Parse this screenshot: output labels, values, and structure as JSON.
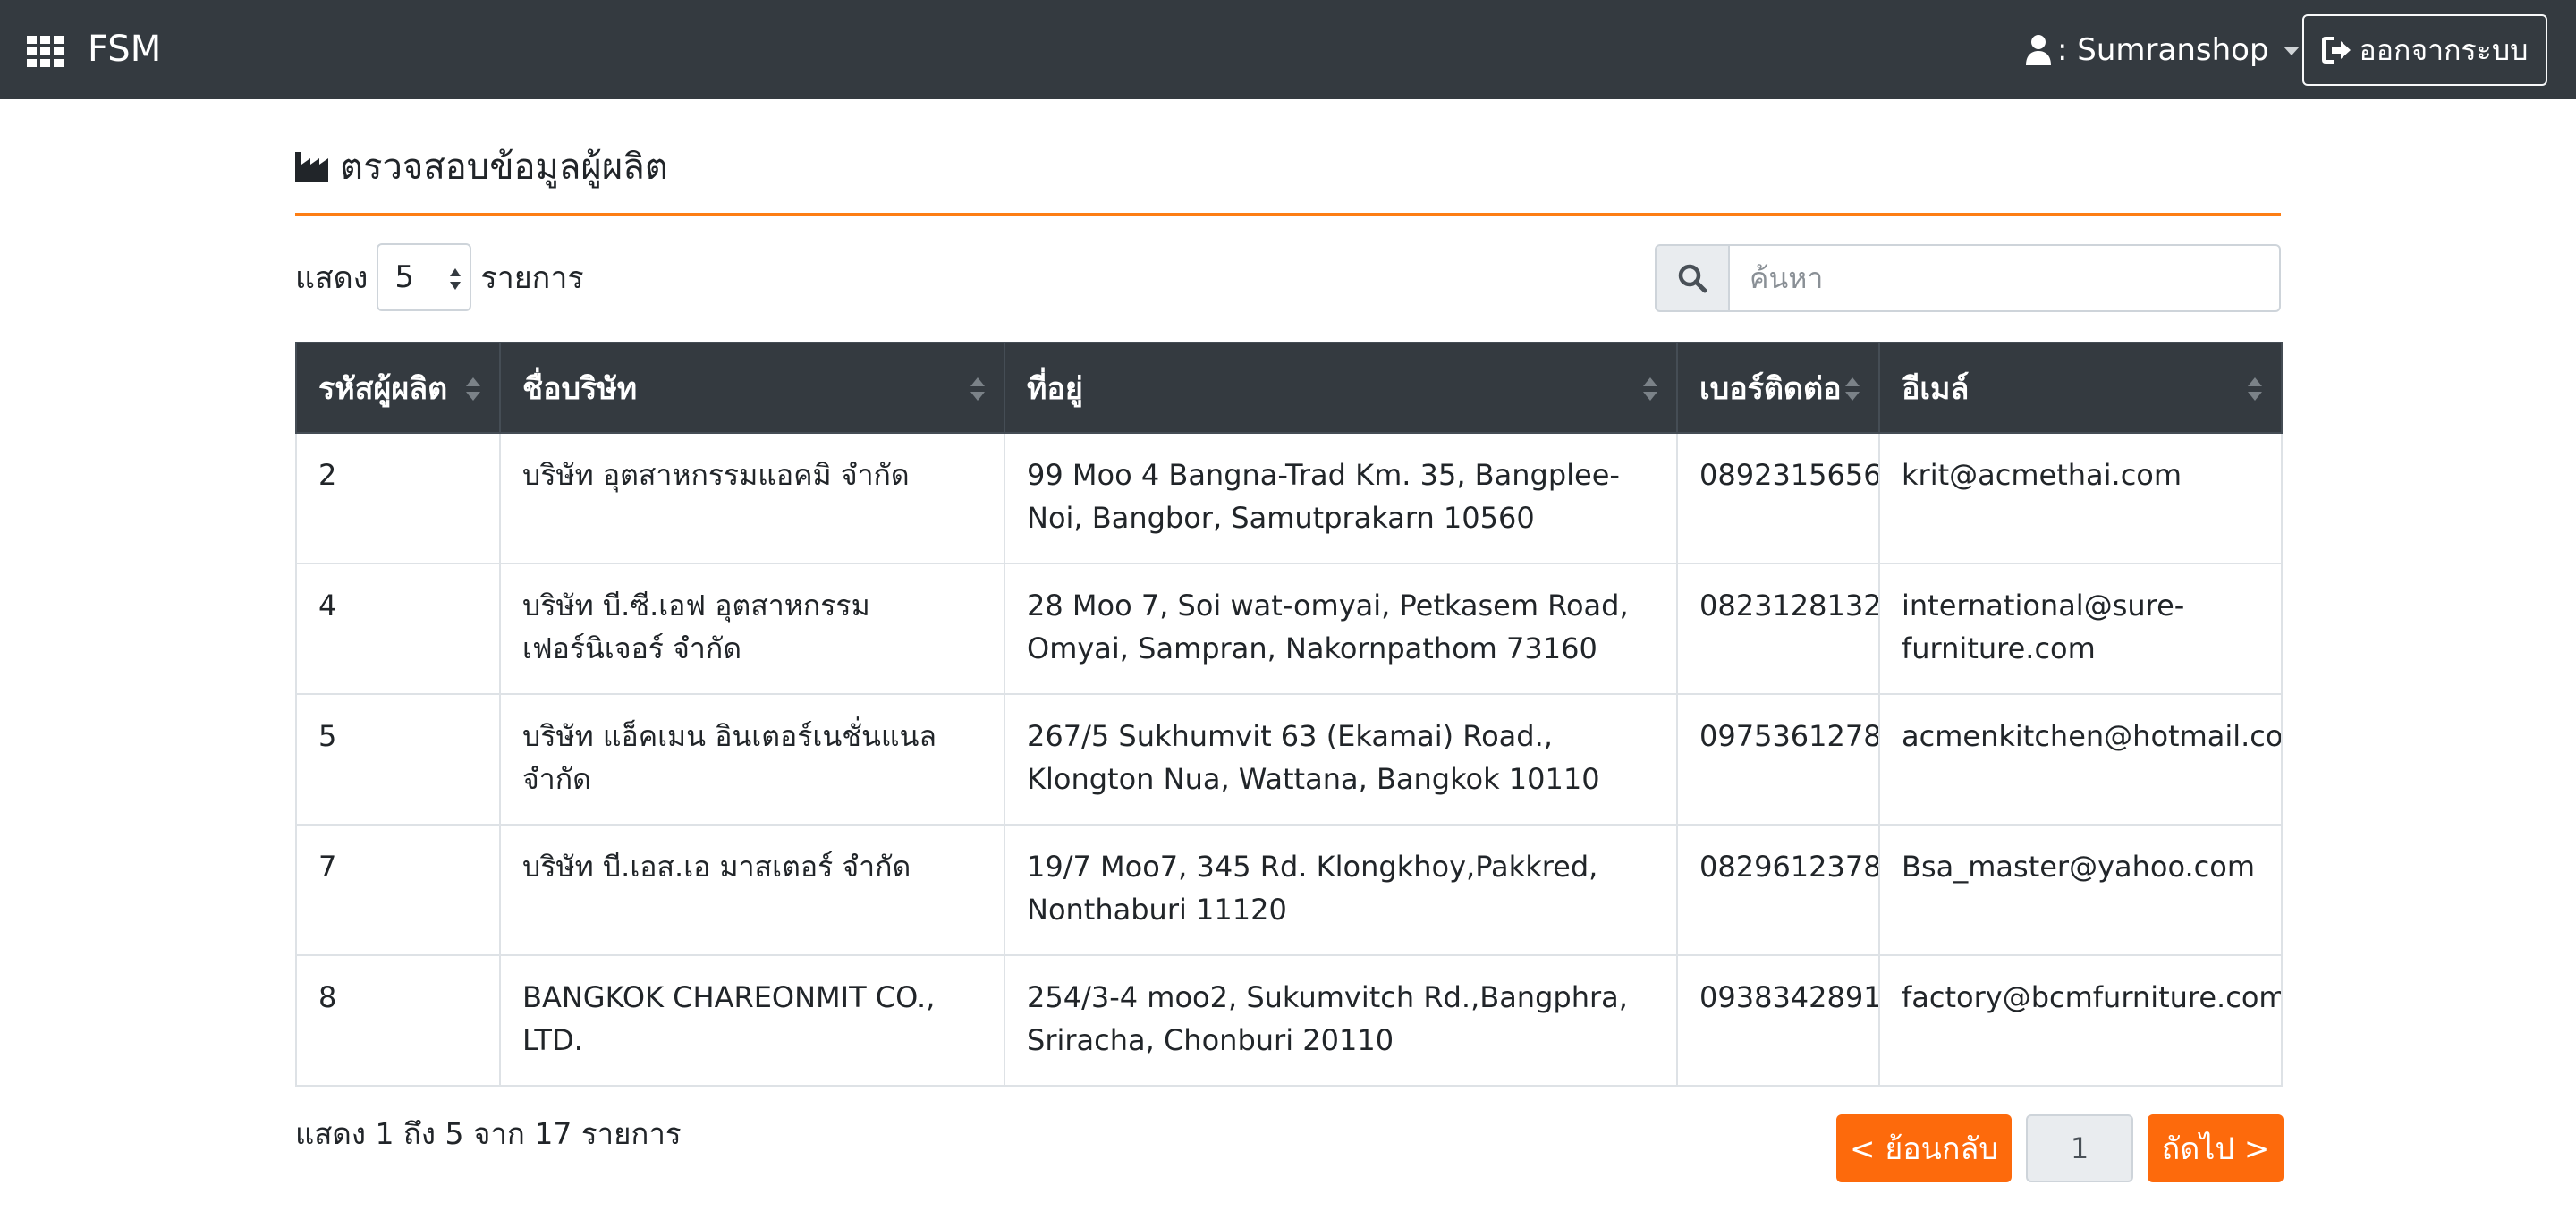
{
  "navbar": {
    "brand": "FSM",
    "apps_icon": "grid-apps-icon",
    "user_label": ": Sumranshop",
    "logout_label": "ออกจากระบบ"
  },
  "page": {
    "title": "ตรวจสอบข้อมูลผู้ผลิต",
    "title_icon": "factory-icon",
    "accent_color": "#fd7e14"
  },
  "length": {
    "show_label": "แสดง",
    "value": "5",
    "entries_label": "รายการ"
  },
  "search": {
    "placeholder": "ค้นหา",
    "value": ""
  },
  "table": {
    "headers": [
      "รหัสผู้ผลิต",
      "ชื่อบริษัท",
      "ที่อยู่",
      "เบอร์ติดต่อ",
      "อีเมล์"
    ],
    "rows": [
      [
        "2",
        "บริษัท อุตสาหกรรมแอคมิ จำกัด",
        "99 Moo 4 Bangna-Trad Km. 35, Bangplee-Noi, Bangbor, Samutprakarn 10560",
        "0892315656",
        "krit@acmethai.com"
      ],
      [
        "4",
        "บริษัท บี.ซี.เอฟ อุตสาหกรรมเฟอร์นิเจอร์ จำกัด",
        "28 Moo 7, Soi wat-omyai, Petkasem Road, Omyai, Sampran, Nakornpathom 73160",
        "0823128132",
        "international@sure-furniture.com"
      ],
      [
        "5",
        "บริษัท แอ็คเมน อินเตอร์เนชั่นแนล จำกัด",
        "267/5 Sukhumvit 63 (Ekamai) Road., Klongton Nua, Wattana, Bangkok 10110",
        "0975361278",
        "acmenkitchen@hotmail.com"
      ],
      [
        "7",
        "บริษัท บี.เอส.เอ มาสเตอร์ จำกัด",
        "19/7 Moo7, 345 Rd. Klongkhoy,Pakkred, Nonthaburi 11120",
        "0829612378",
        "Bsa_master@yahoo.com"
      ],
      [
        "8",
        "BANGKOK CHAREONMIT CO., LTD.",
        "254/3-4 moo2, Sukumvitch Rd.,Bangphra, Sriracha, Chonburi 20110",
        "0938342891",
        "factory@bcmfurniture.com"
      ]
    ]
  },
  "footer": {
    "info": "แสดง 1 ถึง 5 จาก 17 รายการ",
    "prev_label": "< ย้อนกลับ",
    "page": "1",
    "next_label": "ถัดไป >"
  }
}
